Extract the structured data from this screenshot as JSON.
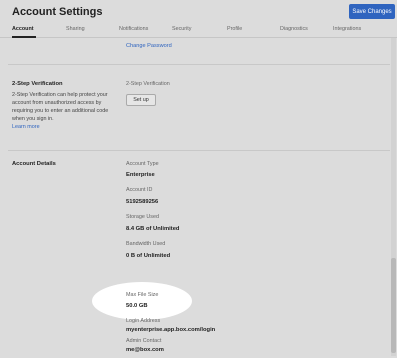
{
  "header": {
    "title": "Account Settings",
    "save_label": "Save Changes"
  },
  "tabs": [
    {
      "label": "Account"
    },
    {
      "label": "Sharing"
    },
    {
      "label": "Notifications"
    },
    {
      "label": "Security"
    },
    {
      "label": "Profile"
    },
    {
      "label": "Diagnostics"
    },
    {
      "label": "Integrations"
    }
  ],
  "password": {
    "change_label": "Change Password"
  },
  "two_step": {
    "section_title": "2-Step Verification",
    "description": "2-Step Verification can help protect your account from unauthorized access by requiring you to enter an additional code when you sign in.",
    "learn_more": "Learn more",
    "field_label": "2-Step Verification",
    "setup_label": "Set up"
  },
  "account_details": {
    "section_title": "Account Details",
    "fields": [
      {
        "label": "Account Type",
        "value": "Enterprise"
      },
      {
        "label": "Account ID",
        "value": "5192589256"
      },
      {
        "label": "Storage Used",
        "value": "8.4 GB of Unlimited"
      },
      {
        "label": "Bandwidth Used",
        "value": "0 B of Unlimited"
      },
      {
        "label": "Max File Size",
        "value": "50.0 GB"
      },
      {
        "label": "Login Address",
        "value": "myenterprise.app.box.com/login"
      },
      {
        "label": "Admin Contact",
        "value": "me@box.com"
      }
    ]
  },
  "colors": {
    "accent": "#2f64bf",
    "background": "#dcdcdc",
    "highlight": "#ffffff"
  }
}
